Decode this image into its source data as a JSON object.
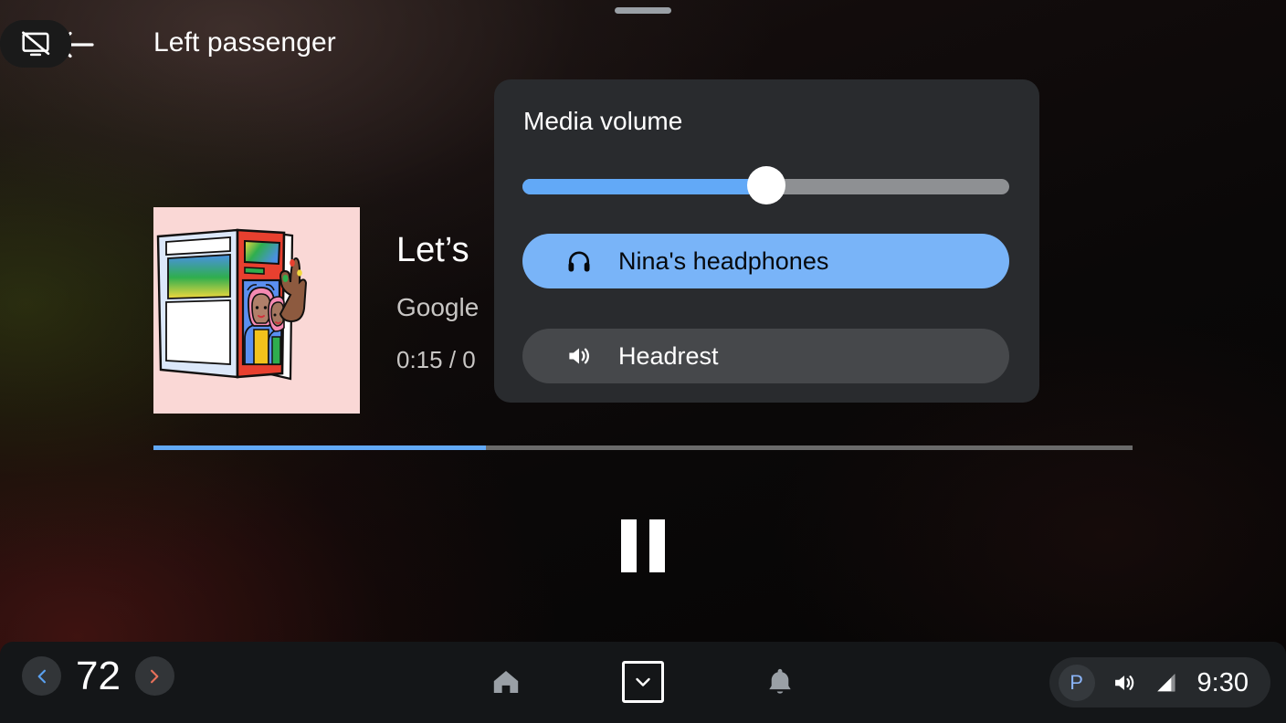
{
  "header": {
    "title": "Left passenger",
    "back_icon": "arrow-left-icon",
    "drag_handle": "panel-drag-handle",
    "actions": [
      {
        "name": "headphones-toggle",
        "icon": "headphones-icon",
        "state": "active"
      },
      {
        "name": "touch-disabled-toggle",
        "icon": "touch-off-icon",
        "state": "inactive"
      },
      {
        "name": "screen-off-toggle",
        "icon": "screen-off-icon",
        "state": "inactive"
      }
    ]
  },
  "now_playing": {
    "title": "Let’s",
    "artist": "Google",
    "time": "0:15 / 0",
    "album_art_alt": "illustration-two-women-pink-hair-magazine",
    "progress_percent": 34,
    "transport": {
      "pause_icon": "pause-icon"
    }
  },
  "media_volume_panel": {
    "title": "Media volume",
    "slider": {
      "name": "media-volume-slider",
      "value_percent": 50,
      "fill_color": "#62a9f7",
      "track_color": "#8e9093",
      "thumb_color": "#ffffff"
    },
    "devices": [
      {
        "label": "Nina's headphones",
        "icon": "headphones-icon",
        "selected": true,
        "color": "#79b4f8"
      },
      {
        "label": "Headrest",
        "icon": "speaker-volume-icon",
        "selected": false,
        "color": "#46484b"
      }
    ]
  },
  "bottom_bar": {
    "climate": {
      "decrease_icon": "chevron-left-icon",
      "decrease_color": "#5aa0ef",
      "temperature": "72",
      "increase_icon": "chevron-right-icon",
      "increase_color": "#e8705a"
    },
    "nav": [
      {
        "name": "home-button",
        "icon": "home-icon"
      },
      {
        "name": "hide-panel-button",
        "icon": "chevron-down-icon"
      },
      {
        "name": "notifications-button",
        "icon": "bell-icon"
      }
    ],
    "status": {
      "park_label": "P",
      "park_color": "#8ab4f8",
      "volume_icon": "speaker-volume-icon",
      "signal_icon": "signal-bars-icon",
      "time": "9:30"
    }
  }
}
